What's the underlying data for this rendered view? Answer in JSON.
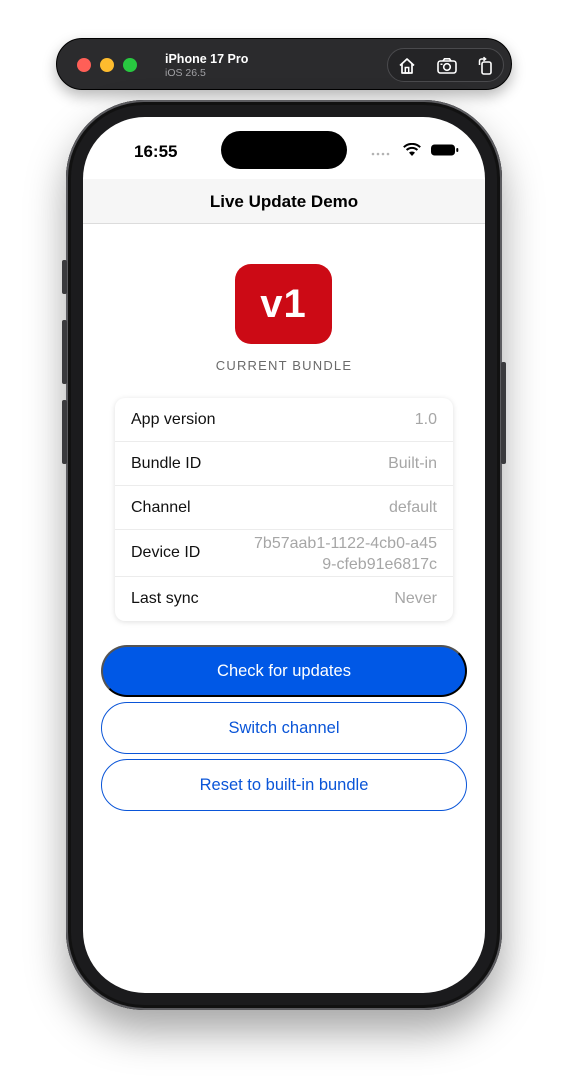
{
  "simulator": {
    "device_name": "iPhone 17 Pro",
    "os_version": "iOS 26.5",
    "tools": [
      {
        "icon": "home-icon"
      },
      {
        "icon": "screenshot-icon"
      },
      {
        "icon": "rotate-icon"
      }
    ]
  },
  "status_bar": {
    "time": "16:55"
  },
  "nav": {
    "title": "Live Update Demo"
  },
  "bundle": {
    "badge": "v1",
    "caption": "CURRENT BUNDLE",
    "badge_color": "#cc0a15"
  },
  "info": {
    "rows": [
      {
        "label": "App version",
        "value": "1.0"
      },
      {
        "label": "Bundle ID",
        "value": "Built-in"
      },
      {
        "label": "Channel",
        "value": "default"
      },
      {
        "label": "Device ID",
        "value": "7b57aab1-1122-4cb0-a459-cfeb91e6817c"
      },
      {
        "label": "Last sync",
        "value": "Never"
      }
    ]
  },
  "actions": {
    "check": "Check for updates",
    "switch": "Switch channel",
    "reset": "Reset to built-in bundle",
    "accent_color": "#0058e6"
  }
}
